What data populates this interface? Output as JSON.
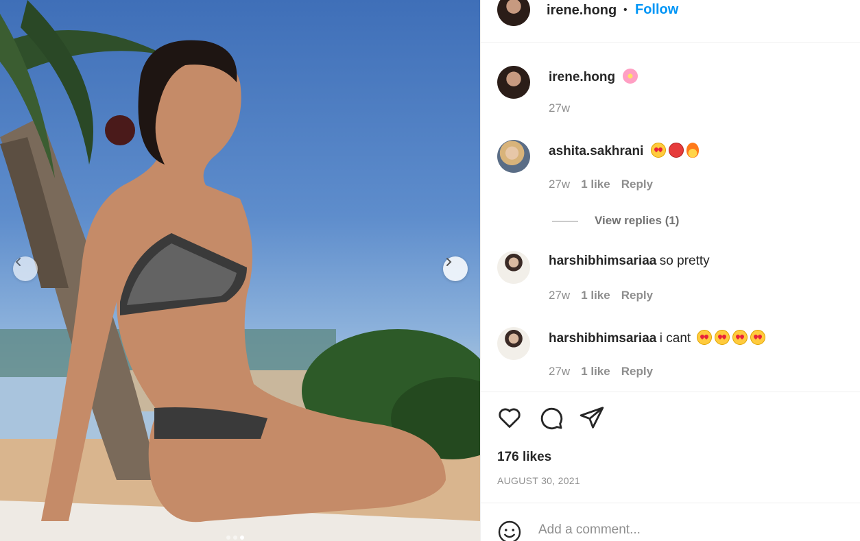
{
  "post": {
    "username": "irene.hong",
    "follow_label": "Follow",
    "separator": "•"
  },
  "caption": {
    "username": "irene.hong",
    "emoji": "cherry-blossom",
    "time": "27w"
  },
  "comments": [
    {
      "username": "ashita.sakhrani",
      "text": "",
      "emojis": [
        "heart-eyes",
        "hot-face",
        "fire"
      ],
      "time": "27w",
      "likes": "1 like",
      "reply": "Reply"
    },
    {
      "username": "harshibhimsariaa",
      "text": "so pretty",
      "emojis": [],
      "time": "27w",
      "likes": "1 like",
      "reply": "Reply"
    },
    {
      "username": "harshibhimsariaa",
      "text": "i cant",
      "emojis": [
        "heart-eyes",
        "heart-eyes",
        "heart-eyes",
        "heart-eyes"
      ],
      "time": "27w",
      "likes": "1 like",
      "reply": "Reply"
    }
  ],
  "view_replies": "View replies (1)",
  "likes": "176 likes",
  "date": "AUGUST 30, 2021",
  "add_comment": {
    "placeholder": "Add a comment..."
  },
  "colors": {
    "follow": "#0095f6",
    "meta": "#8e8e8e",
    "border": "#efefef"
  },
  "icons": [
    "chevron-left-icon",
    "chevron-right-icon",
    "heart-icon",
    "comment-icon",
    "share-icon",
    "smile-icon"
  ],
  "carousel": {
    "slides": 3,
    "active": 3
  }
}
